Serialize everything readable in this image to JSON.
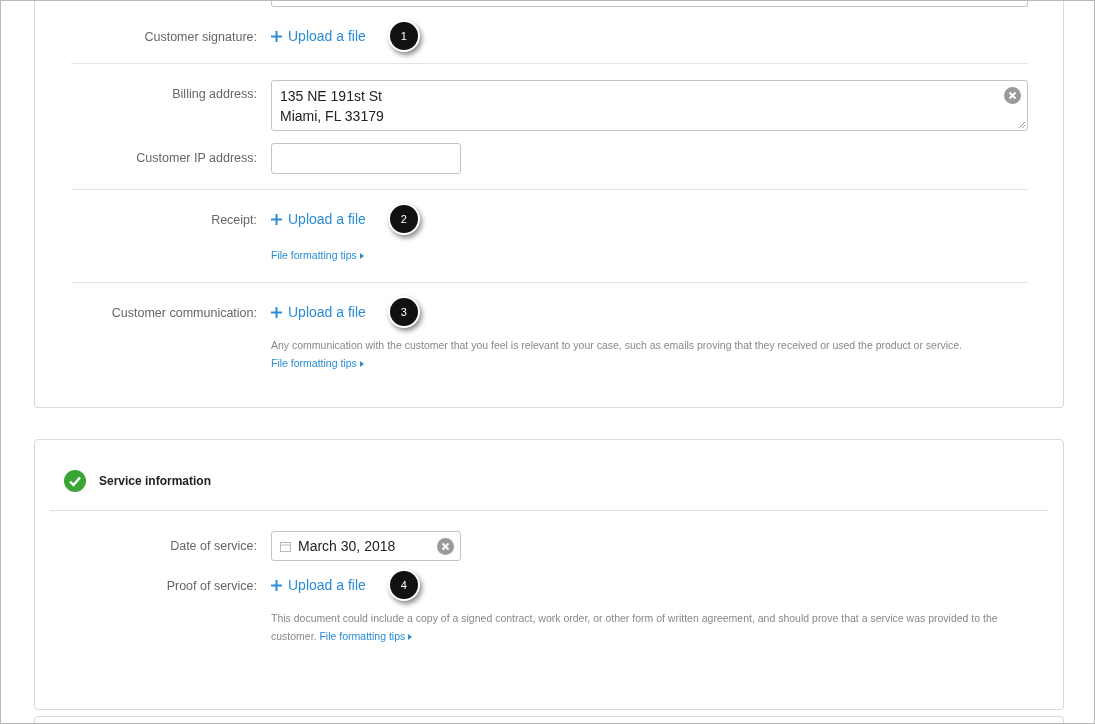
{
  "sections": [
    {
      "rows": [
        {
          "kind": "partial-input",
          "separated": false
        },
        {
          "kind": "upload",
          "separated": false,
          "label": "Customer signature:",
          "action": "Upload a file",
          "callout": "1"
        },
        {
          "kind": "textarea",
          "separated": true,
          "label": "Billing address:",
          "value": "135 NE 191st St\nMiami, FL 33179"
        },
        {
          "kind": "input",
          "separated": false,
          "label": "Customer IP address:"
        },
        {
          "kind": "upload",
          "separated": true,
          "label": "Receipt:",
          "action": "Upload a file",
          "callout": "2",
          "tips": "File formatting tips"
        },
        {
          "kind": "upload",
          "separated": true,
          "label": "Customer communication:",
          "action": "Upload a file",
          "callout": "3",
          "help": "Any communication with the customer that you feel is relevant to your case, such as emails proving that they received or used the product or service.",
          "tips": "File formatting tips"
        }
      ]
    },
    {
      "header": {
        "title": "Service information",
        "complete": true
      },
      "rows": [
        {
          "kind": "date",
          "separated": false,
          "label": "Date of service:",
          "value": "March 30, 2018"
        },
        {
          "kind": "upload",
          "separated": false,
          "label": "Proof of service:",
          "action": "Upload a file",
          "callout": "4",
          "help": "This document could include a copy of a signed contract, work order, or other form of written agreement, and should prove that a service was provided to the customer.",
          "tips": "File formatting tips"
        }
      ]
    }
  ]
}
